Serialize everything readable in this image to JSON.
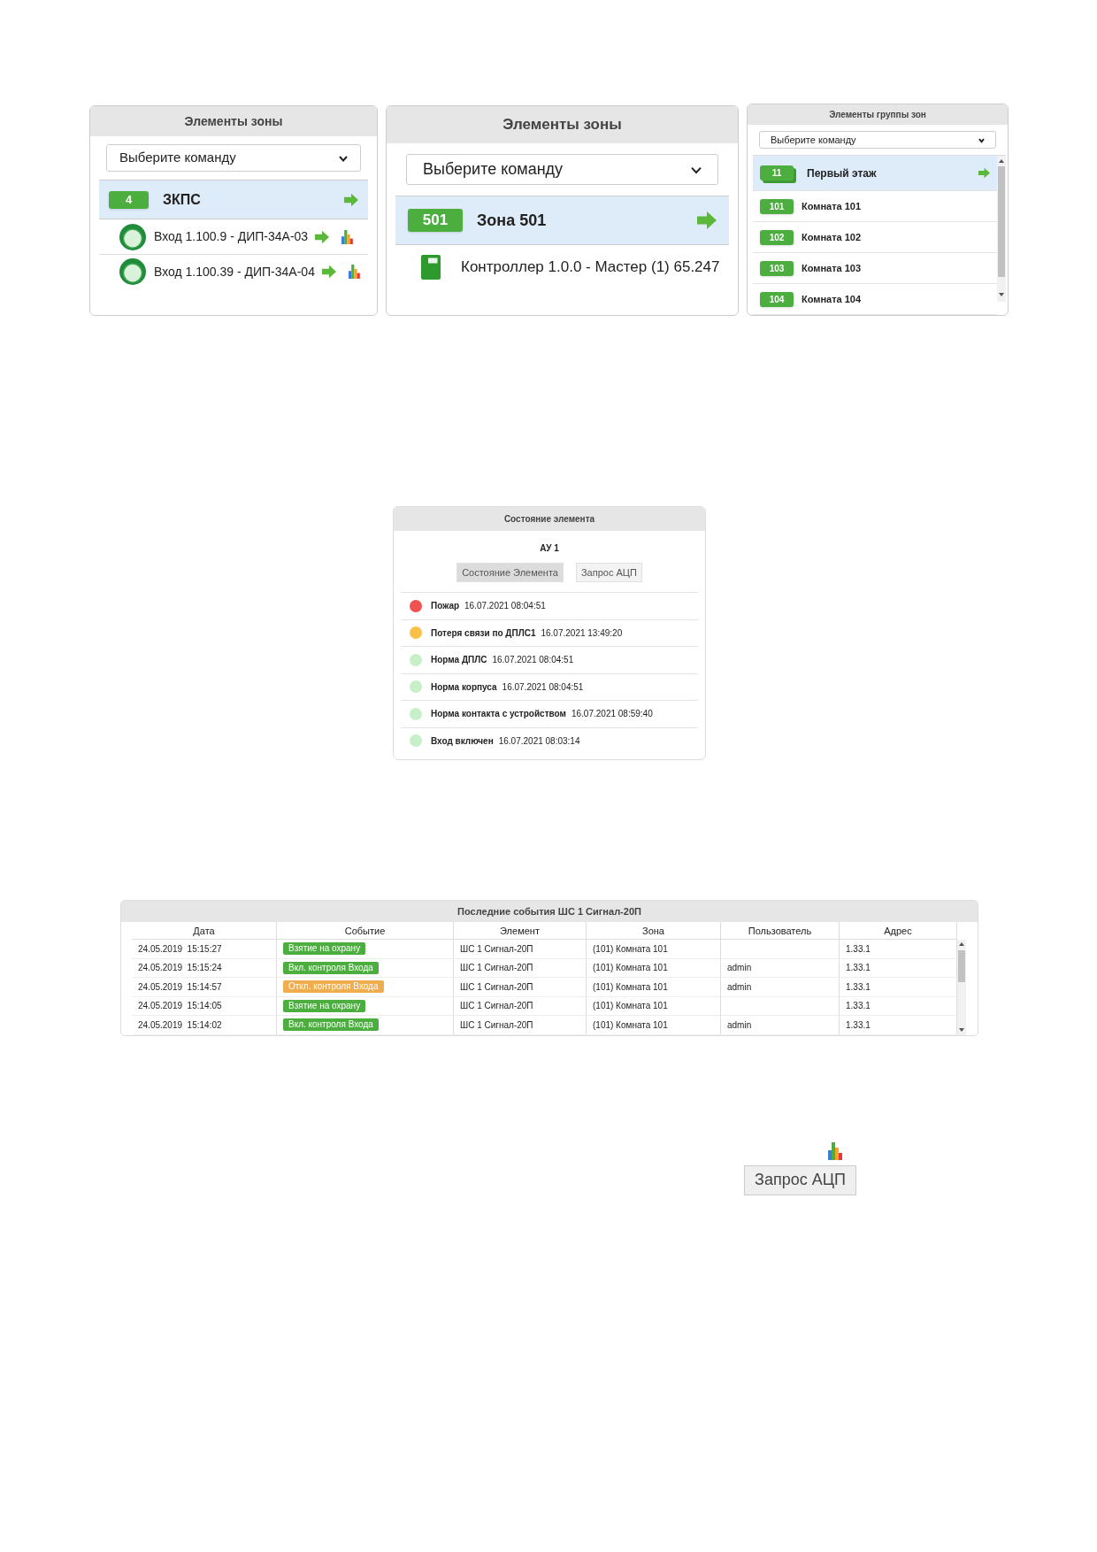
{
  "zone_panels": [
    {
      "title": "Элементы зоны",
      "command": "Выберите команду",
      "zone": {
        "number": "4",
        "name": "ЗКПС",
        "selected": true
      },
      "elements": [
        {
          "kind": "detector",
          "label": "Вход 1.100.9 - ДИП-34А-03",
          "chart": true
        },
        {
          "kind": "detector",
          "label": "Вход 1.100.39 - ДИП-34А-04",
          "chart": true
        }
      ]
    },
    {
      "title": "Элементы зоны",
      "command": "Выберите команду",
      "zone": {
        "number": "501",
        "name": "Зона 501",
        "selected": true
      },
      "elements": [
        {
          "kind": "controller",
          "label": "Контроллер 1.0.0 - Мастер (1) 65.247"
        }
      ]
    }
  ],
  "group_panel": {
    "title": "Элементы группы зон",
    "command": "Выберите команду",
    "zones": [
      {
        "kind": "group",
        "number": "11",
        "name": "Первый этаж",
        "selected": true
      },
      {
        "kind": "zone",
        "number": "101",
        "name": "Комната 101",
        "selected": false
      },
      {
        "kind": "zone",
        "number": "102",
        "name": "Комната 102",
        "selected": false
      },
      {
        "kind": "zone",
        "number": "103",
        "name": "Комната 103",
        "selected": false
      },
      {
        "kind": "zone",
        "number": "104",
        "name": "Комната 104",
        "selected": false
      }
    ]
  },
  "state_panel": {
    "title": "Состояние элемента",
    "element": "АУ 1",
    "buttons": [
      {
        "label": "Состояние Элемента",
        "selected": true
      },
      {
        "label": "Запрос АЦП",
        "selected": false
      }
    ],
    "states": [
      {
        "name": "Пожар",
        "time": "16.07.2021 08:04:51",
        "color": "#ef5350"
      },
      {
        "name": "Потеря связи по ДПЛС1",
        "time": "16.07.2021 13:49:20",
        "color": "#fbc04a"
      },
      {
        "name": "Норма ДПЛС",
        "time": "16.07.2021 08:04:51",
        "color": "#c8f0c8"
      },
      {
        "name": "Норма корпуса",
        "time": "16.07.2021 08:04:51",
        "color": "#c8f0c8"
      },
      {
        "name": "Норма контакта с устройством",
        "time": "16.07.2021 08:59:40",
        "color": "#c8f0c8"
      },
      {
        "name": "Вход включен",
        "time": "16.07.2021 08:03:14",
        "color": "#c8f0c8"
      }
    ]
  },
  "events_table": {
    "title": "Последние события ШС 1 Сигнал-20П",
    "columns": [
      "Дата",
      "Событие",
      "Элемент",
      "Зона",
      "Пользователь",
      "Адрес"
    ],
    "rows": [
      {
        "date": "24.05.2019  15:15:27",
        "event": "Взятие на охрану",
        "color": "#4cae3f",
        "element": "ШС 1 Сигнал-20П",
        "zone": "(101) Комната 101",
        "user": "",
        "address": "1.33.1"
      },
      {
        "date": "24.05.2019  15:15:24",
        "event": "Вкл. контроля Входа",
        "color": "#4cae3f",
        "element": "ШС 1 Сигнал-20П",
        "zone": "(101) Комната 101",
        "user": "admin",
        "address": "1.33.1"
      },
      {
        "date": "24.05.2019  15:14:57",
        "event": "Откл. контроля Входа",
        "color": "#f0ad4e",
        "element": "ШС 1 Сигнал-20П",
        "zone": "(101) Комната 101",
        "user": "admin",
        "address": "1.33.1"
      },
      {
        "date": "24.05.2019  15:14:05",
        "event": "Взятие на охрану",
        "color": "#4cae3f",
        "element": "ШС 1 Сигнал-20П",
        "zone": "(101) Комната 101",
        "user": "",
        "address": "1.33.1"
      },
      {
        "date": "24.05.2019  15:14:02",
        "event": "Вкл. контроля Входа",
        "color": "#4cae3f",
        "element": "ШС 1 Сигнал-20П",
        "zone": "(101) Комната 101",
        "user": "admin",
        "address": "1.33.1"
      }
    ]
  },
  "adc_button": {
    "label": "Запрос АЦП"
  }
}
